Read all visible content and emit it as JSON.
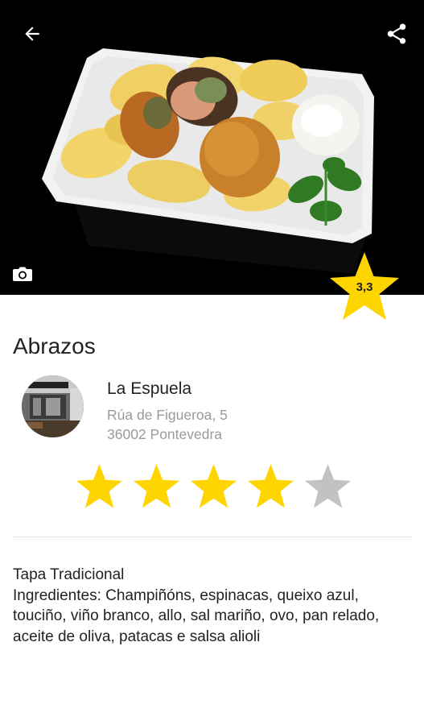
{
  "header": {
    "back_icon": "arrow-left-icon",
    "share_icon": "share-icon",
    "camera_icon": "camera-icon"
  },
  "rating": {
    "value_label": "3,3",
    "value": 3.3,
    "badge_color": "#FFD500"
  },
  "dish": {
    "name": "Abrazos"
  },
  "venue": {
    "name": "La Espuela",
    "address_line1": "Rúa de Figueroa, 5",
    "address_line2": "36002 Pontevedra"
  },
  "user_rating": {
    "filled": 4,
    "max": 5,
    "filled_color": "#FFD500",
    "empty_color": "#C2C2C2"
  },
  "description": {
    "category": "Tapa Tradicional",
    "ingredients": "Ingredientes: Champiñóns, espinacas, queixo azul, touciño, viño branco, allo, sal mariño, ovo, pan relado, aceite de oliva, patacas e salsa alioli"
  }
}
